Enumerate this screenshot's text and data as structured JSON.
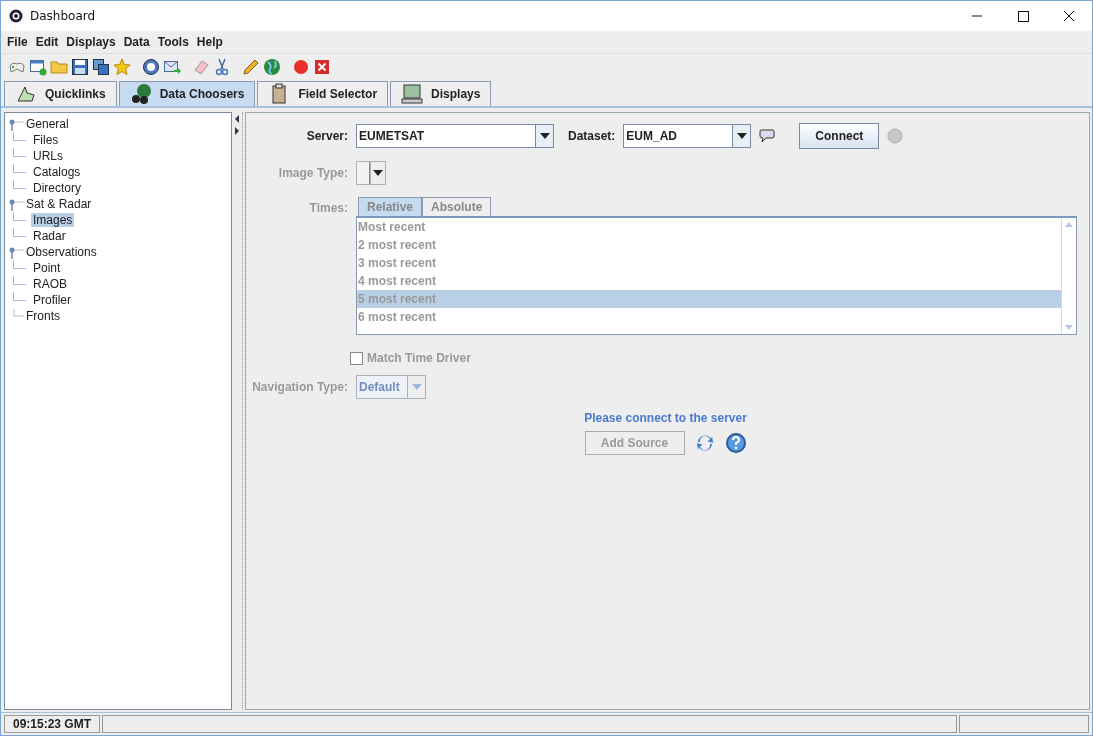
{
  "window": {
    "title": "Dashboard"
  },
  "menu": [
    {
      "label": "File"
    },
    {
      "label": "Edit"
    },
    {
      "label": "Displays"
    },
    {
      "label": "Data"
    },
    {
      "label": "Tools"
    },
    {
      "label": "Help"
    }
  ],
  "tabs": [
    {
      "label": "Quicklinks",
      "selected": false
    },
    {
      "label": "Data Choosers",
      "selected": true
    },
    {
      "label": "Field Selector",
      "selected": false
    },
    {
      "label": "Displays",
      "selected": false
    }
  ],
  "tree": [
    {
      "label": "General",
      "expanded": true,
      "selected": false,
      "children": [
        {
          "label": "Files",
          "selected": false
        },
        {
          "label": "URLs",
          "selected": false
        },
        {
          "label": "Catalogs",
          "selected": false
        },
        {
          "label": "Directory",
          "selected": false
        }
      ]
    },
    {
      "label": "Sat & Radar",
      "expanded": true,
      "selected": false,
      "children": [
        {
          "label": "Images",
          "selected": true
        },
        {
          "label": "Radar",
          "selected": false
        }
      ]
    },
    {
      "label": "Observations",
      "expanded": true,
      "selected": false,
      "children": [
        {
          "label": "Point",
          "selected": false
        },
        {
          "label": "RAOB",
          "selected": false
        },
        {
          "label": "Profiler",
          "selected": false
        }
      ]
    },
    {
      "label": "Fronts",
      "expanded": false,
      "selected": false
    }
  ],
  "form": {
    "server": {
      "label": "Server:",
      "value": "EUMETSAT"
    },
    "dataset": {
      "label": "Dataset:",
      "value": "EUM_AD"
    },
    "connect": "Connect",
    "image_type": {
      "label": "Image Type:",
      "disabled": true
    },
    "times": {
      "label": "Times:",
      "disabled": true,
      "tabs": [
        {
          "label": "Relative",
          "selected": true
        },
        {
          "label": "Absolute",
          "selected": false
        }
      ],
      "items": [
        {
          "label": "Most recent",
          "selected": false
        },
        {
          "label": "2 most recent",
          "selected": false
        },
        {
          "label": "3 most recent",
          "selected": false
        },
        {
          "label": "4 most recent",
          "selected": false
        },
        {
          "label": "5 most recent",
          "selected": true
        },
        {
          "label": "6 most recent",
          "selected": false
        }
      ]
    },
    "match_time_driver": {
      "label": "Match Time Driver",
      "checked": false,
      "disabled": true
    },
    "navigation_type": {
      "label": "Navigation Type:",
      "value": "Default",
      "disabled": true
    },
    "message": "Please connect to the server",
    "add_source": {
      "label": "Add Source",
      "disabled": true
    }
  },
  "status_bar": {
    "time": "09:15:23 GMT"
  }
}
